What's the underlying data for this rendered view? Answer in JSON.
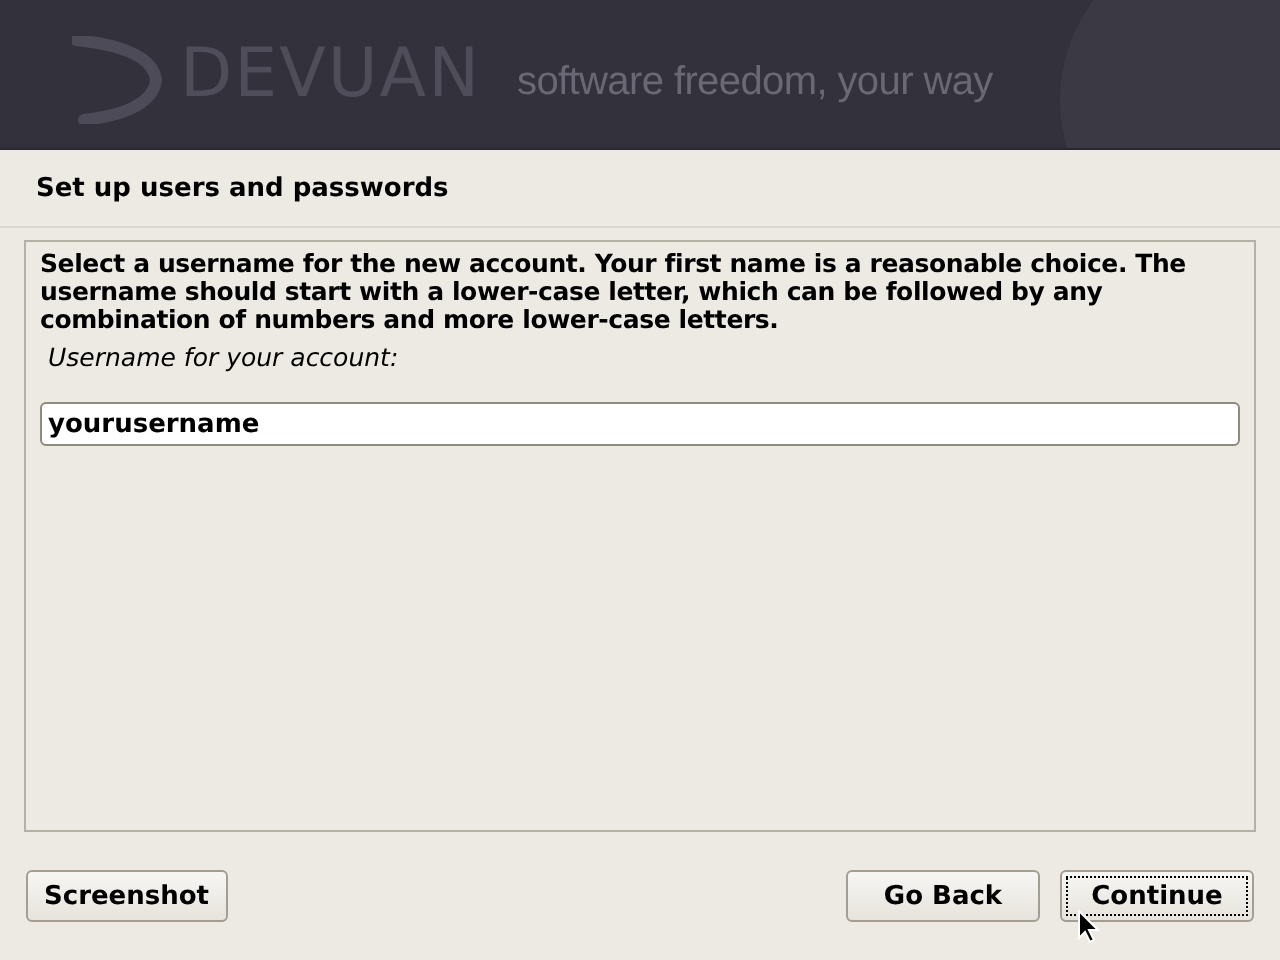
{
  "banner": {
    "logo": "DEVUAN",
    "tagline": "software freedom, your way"
  },
  "step_title": "Set up users and passwords",
  "description": "Select a username for the new account. Your first name is a reasonable choice. The username should start with a lower-case letter, which can be followed by any combination of numbers and more lower-case letters.",
  "field": {
    "label": "Username for your account:",
    "value": "yourusername"
  },
  "left_buttons": [
    {
      "label": "Screenshot",
      "focused": false
    }
  ],
  "right_buttons": [
    {
      "label": "Go Back",
      "focused": false
    },
    {
      "label": "Continue",
      "focused": true
    }
  ]
}
